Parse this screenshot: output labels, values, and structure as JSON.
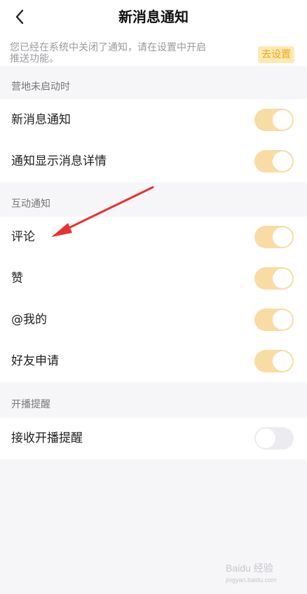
{
  "header": {
    "title": "新消息通知"
  },
  "notice": {
    "text_line1": "您已经在系统中关闭了通知，请在设置中开启",
    "text_line2": "推送功能。",
    "button_label": "去设置"
  },
  "sections": [
    {
      "label": "营地未启动时",
      "rows": [
        {
          "label": "新消息通知",
          "enabled": true
        },
        {
          "label": "通知显示消息详情",
          "enabled": true
        }
      ]
    },
    {
      "label": "互动通知",
      "rows": [
        {
          "label": "评论",
          "enabled": true
        },
        {
          "label": "赞",
          "enabled": true
        },
        {
          "label": "@我的",
          "enabled": true
        },
        {
          "label": "好友申请",
          "enabled": true
        }
      ]
    },
    {
      "label": "开播提醒",
      "rows": [
        {
          "label": "接收开播提醒",
          "enabled": false
        }
      ]
    }
  ],
  "colors": {
    "accent_toggle_on": "#f9dca4",
    "toggle_off": "#ececf0",
    "go_settings_bg": "#fde9b4",
    "go_settings_text": "#f0a81a",
    "annotation_arrow": "#e8322f"
  },
  "watermark": {
    "text": "Baidu 经验",
    "sub": "jingyan.baidu.com"
  }
}
